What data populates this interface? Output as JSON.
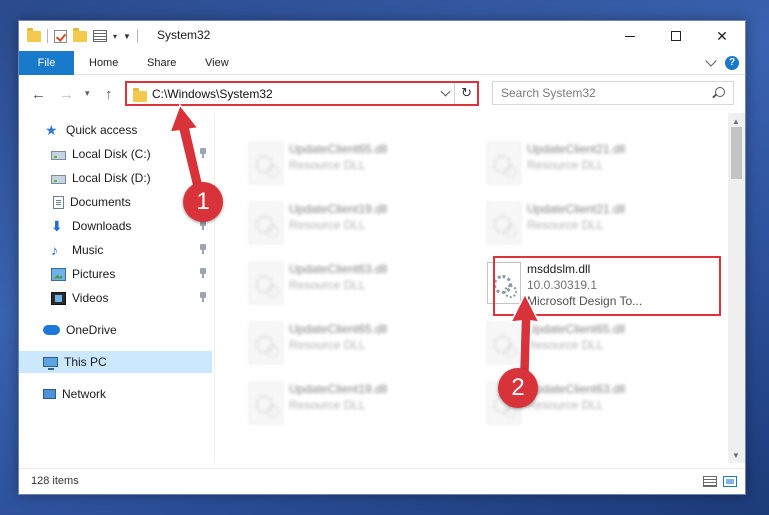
{
  "window": {
    "title": "System32"
  },
  "ribbon": {
    "tabs": [
      "File",
      "Home",
      "Share",
      "View"
    ]
  },
  "address": {
    "path": "C:\\Windows\\System32"
  },
  "search": {
    "placeholder": "Search System32"
  },
  "nav": {
    "items": [
      {
        "label": "Quick access",
        "icon": "star-icon",
        "pinned": false
      },
      {
        "label": "Local Disk (C:)",
        "icon": "drive-icon",
        "pinned": true
      },
      {
        "label": "Local Disk (D:)",
        "icon": "drive-icon",
        "pinned": false
      },
      {
        "label": "Documents",
        "icon": "documents-icon",
        "pinned": true
      },
      {
        "label": "Downloads",
        "icon": "downloads-icon",
        "pinned": true
      },
      {
        "label": "Music",
        "icon": "music-icon",
        "pinned": true
      },
      {
        "label": "Pictures",
        "icon": "pictures-icon",
        "pinned": true
      },
      {
        "label": "Videos",
        "icon": "videos-icon",
        "pinned": true
      },
      {
        "label": "OneDrive",
        "icon": "onedrive-icon",
        "pinned": false
      },
      {
        "label": "This PC",
        "icon": "this-pc-icon",
        "pinned": false,
        "selected": true
      },
      {
        "label": "Network",
        "icon": "network-icon",
        "pinned": false
      }
    ]
  },
  "files": [
    {
      "name": "UpdateClient65.dll",
      "desc": "Resource DLL"
    },
    {
      "name": "UpdateClient21.dll",
      "desc": "Resource DLL"
    },
    {
      "name": "UpdateClient19.dll",
      "desc": "Resource DLL"
    },
    {
      "name": "UpdateClient21.dll",
      "desc": "Resource DLL"
    },
    {
      "name": "UpdateClient63.dll",
      "desc": "Resource DLL"
    },
    {
      "name": "msddslm.dll",
      "desc": "10.0.30319.1",
      "extra": "Microsoft Design To..."
    },
    {
      "name": "UpdateClient65.dll",
      "desc": "Resource DLL"
    },
    {
      "name": "UpdateClient65.dll",
      "desc": "Resource DLL"
    },
    {
      "name": "UpdateClient19.dll",
      "desc": "Resource DLL"
    },
    {
      "name": "UpdateClient63.dll",
      "desc": "Resource DLL"
    }
  ],
  "status": {
    "count": "128 items"
  },
  "annotations": {
    "step1": "1",
    "step2": "2"
  },
  "colors": {
    "accent": "#1979ca",
    "highlight": "#e0303a",
    "selection": "#cce8ff"
  }
}
